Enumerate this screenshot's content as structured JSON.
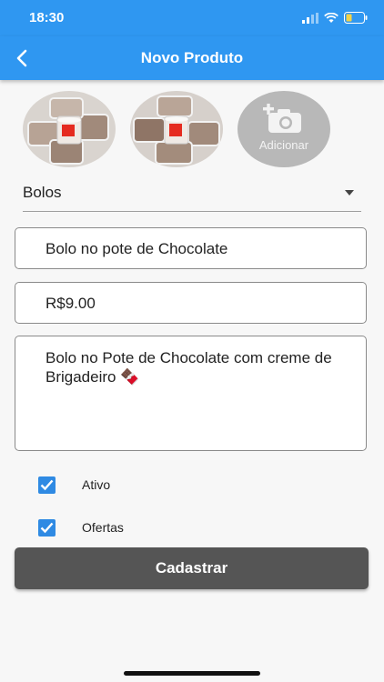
{
  "status_bar": {
    "time": "18:30"
  },
  "appbar": {
    "title": "Novo Produto"
  },
  "photos": {
    "add_label": "Adicionar"
  },
  "category": {
    "selected": "Bolos"
  },
  "form": {
    "name": "Bolo no pote de Chocolate",
    "price": "R$9.00",
    "description": "Bolo no Pote de Chocolate com creme de Brigadeiro 🍫"
  },
  "checkboxes": [
    {
      "label": "Ativo",
      "checked": true
    },
    {
      "label": "Ofertas",
      "checked": true
    }
  ],
  "submit": {
    "label": "Cadastrar"
  },
  "colors": {
    "accent": "#2f97f1",
    "button": "#555555",
    "checkbox": "#2f8ae3"
  },
  "icons": [
    "back-arrow-icon",
    "add-photo-camera-icon",
    "dropdown-caret-icon",
    "check-icon",
    "wifi-icon",
    "signal-icon",
    "battery-icon"
  ]
}
